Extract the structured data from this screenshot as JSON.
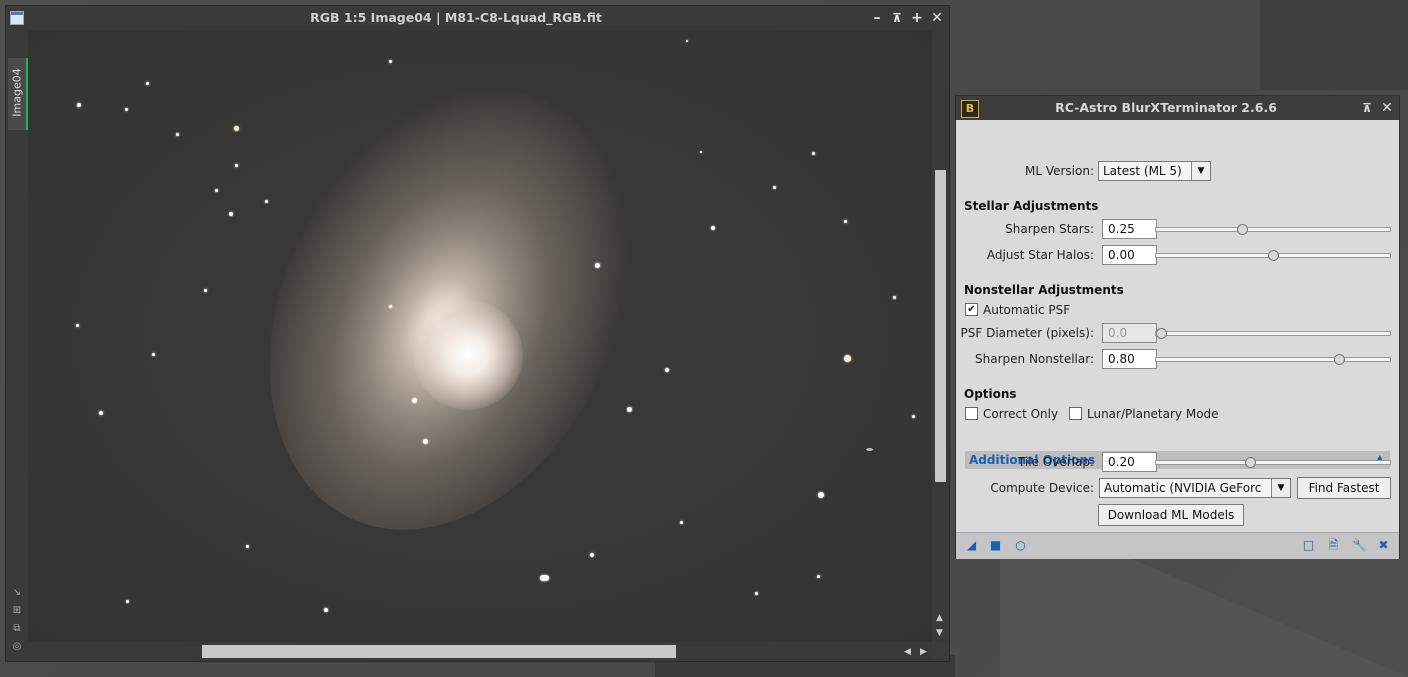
{
  "image_window": {
    "title": "RGB 1:5 Image04 | M81-C8-Lquad_RGB.fit",
    "tab_label": "Image04"
  },
  "dialog": {
    "title": "RC-Astro BlurXTerminator 2.6.6",
    "logo_letter": "B",
    "ml_version": {
      "label": "ML Version:",
      "value": "Latest (ML 5)"
    },
    "stellar": {
      "heading": "Stellar Adjustments",
      "sharpen_stars": {
        "label": "Sharpen Stars:",
        "value": "0.25",
        "level": 0.25
      },
      "adjust_halos": {
        "label": "Adjust Star Halos:",
        "value": "0.00",
        "level": 0.5
      }
    },
    "nonstellar": {
      "heading": "Nonstellar Adjustments",
      "auto_psf": {
        "label": "Automatic PSF",
        "checked": true
      },
      "psf_diameter": {
        "label": "PSF Diameter (pixels):",
        "value": "0.0",
        "level": 0.0
      },
      "sharpen_nonstellar": {
        "label": "Sharpen Nonstellar:",
        "value": "0.80",
        "level": 0.8
      }
    },
    "options": {
      "heading": "Options",
      "correct_only": {
        "label": "Correct Only",
        "checked": false
      },
      "lunar_mode": {
        "label": "Lunar/Planetary Mode",
        "checked": false
      }
    },
    "additional": {
      "heading": "Additional Options",
      "tile_overlap": {
        "label": "Tile Overlap:",
        "value": "0.20",
        "level": 0.4
      },
      "compute_device": {
        "label": "Compute Device:",
        "value": "Automatic (NVIDIA GeForc"
      },
      "find_fastest": "Find Fastest",
      "download": "Download ML Models"
    }
  }
}
